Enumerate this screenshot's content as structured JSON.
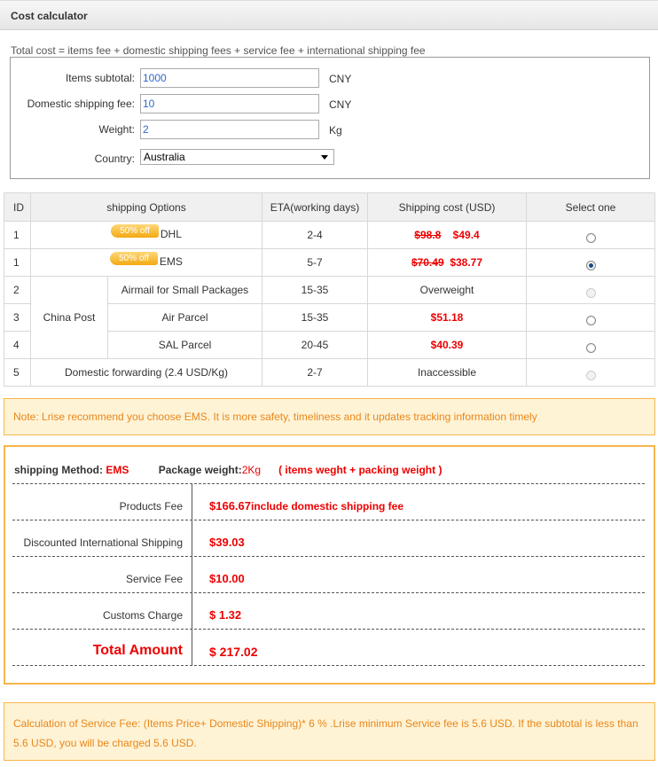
{
  "header": {
    "title": "Cost calculator"
  },
  "form": {
    "formula": "Total cost = items fee + domestic shipping fees + service fee + international shipping fee",
    "items_subtotal": {
      "label": "Items subtotal:",
      "value": "1000",
      "unit": "CNY"
    },
    "domestic_fee": {
      "label": "Domestic shipping fee:",
      "value": "10",
      "unit": "CNY"
    },
    "weight": {
      "label": "Weight:",
      "value": "2",
      "unit": "Kg"
    },
    "country": {
      "label": "Country:",
      "value": "Australia"
    }
  },
  "shipping_table": {
    "headers": {
      "id": "ID",
      "options": "shipping Options",
      "eta": "ETA(working days)",
      "cost": "Shipping cost (USD)",
      "select": "Select one"
    },
    "rows": {
      "dhl": {
        "id": "1",
        "badge": "50%  off",
        "name": "DHL",
        "eta": "2-4",
        "old_price": "$98.8",
        "price": "$49.4",
        "state": "unchecked"
      },
      "ems": {
        "id": "1",
        "badge": "50%  off",
        "name": "EMS",
        "eta": "5-7",
        "old_price": "$70.49",
        "price": "$38.77",
        "state": "checked"
      },
      "airmail": {
        "id": "2",
        "group": "China Post",
        "name": "Airmail for Small Packages",
        "eta": "15-35",
        "cost": "Overweight",
        "state": "disabled"
      },
      "airparcel": {
        "id": "3",
        "name": "Air Parcel",
        "eta": "15-35",
        "price": "$51.18",
        "state": "unchecked"
      },
      "sal": {
        "id": "4",
        "name": "SAL Parcel",
        "eta": "20-45",
        "price": "$40.39",
        "state": "unchecked"
      },
      "domestic": {
        "id": "5",
        "name": "Domestic forwarding (2.4 USD/Kg)",
        "eta": "2-7",
        "cost": "Inaccessible",
        "state": "disabled"
      }
    }
  },
  "note": {
    "text": "Note: Lrise recommend you choose EMS. It is more safety, timeliness and it updates tracking information timely"
  },
  "summary": {
    "method_label": "shipping Method:",
    "method_value": "EMS",
    "weight_label": "Package weight:",
    "weight_value": "2Kg",
    "weight_note": "( items weght + packing weight )",
    "products_fee": {
      "label": "Products Fee",
      "value": "$166.67",
      "suffix": "include domestic shipping fee"
    },
    "intl_shipping": {
      "label": "Discounted International Shipping",
      "value": "$39.03"
    },
    "service_fee": {
      "label": "Service Fee",
      "value": "$10.00"
    },
    "customs": {
      "label": "Customs Charge",
      "value": "$ 1.32"
    },
    "total": {
      "label": "Total Amount",
      "value": "$ 217.02"
    }
  },
  "calc_note": {
    "text": "Calculation of Service Fee: (Items Price+ Domestic Shipping)* 6 % .Lrise minimum Service fee is 5.6 USD. If the subtotal is less than 5.6 USD, you will be charged 5.6 USD."
  }
}
